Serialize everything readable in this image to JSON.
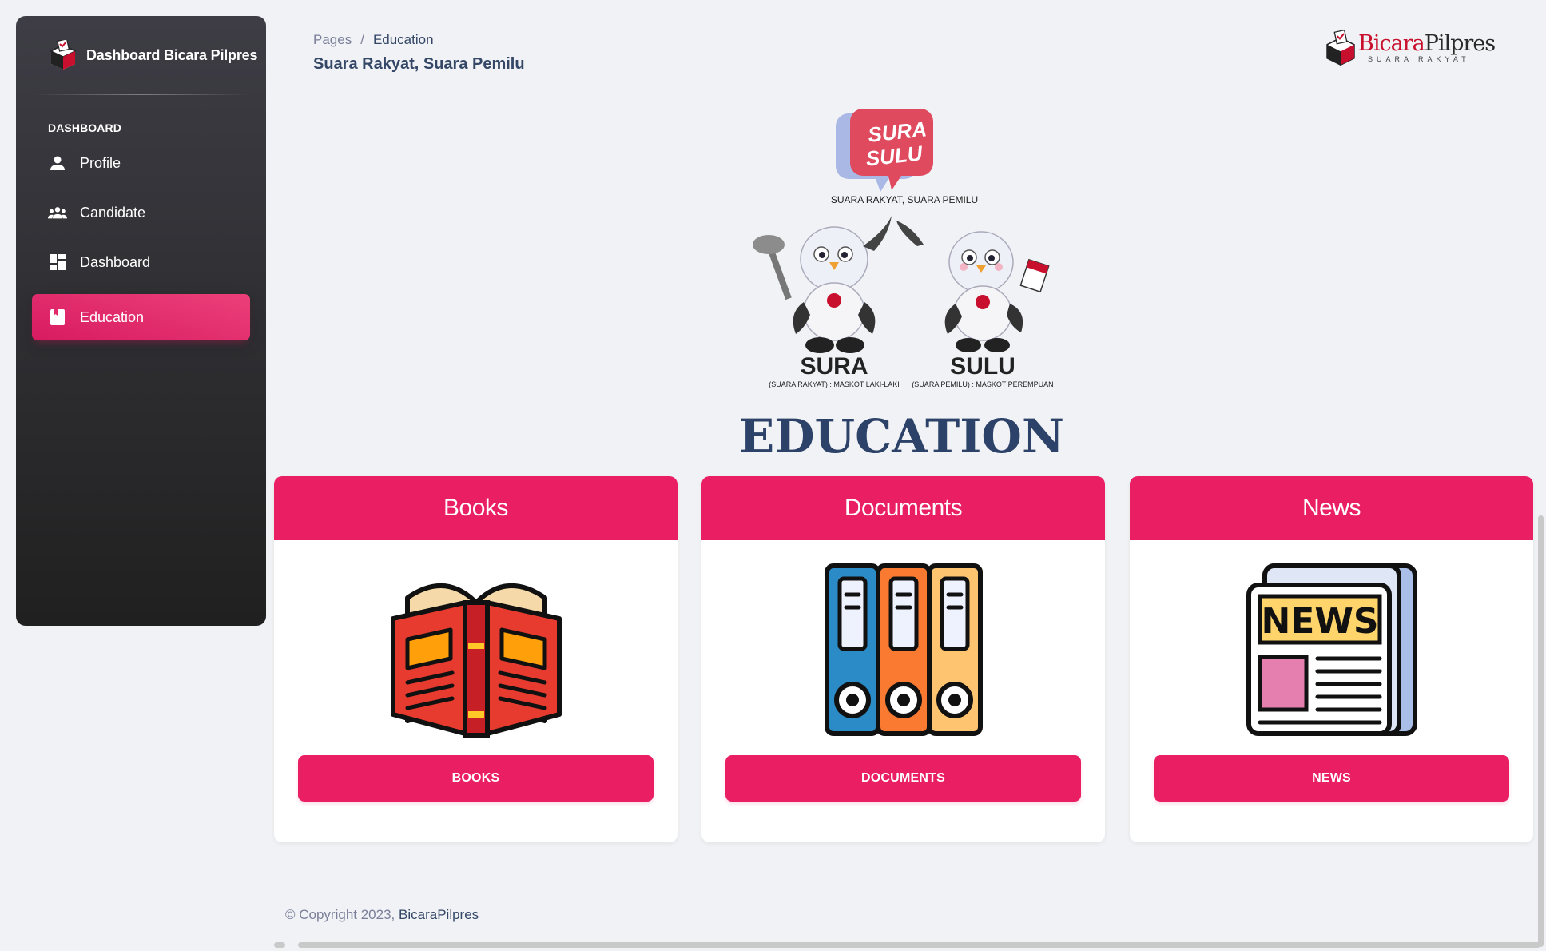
{
  "sidebar": {
    "brand": "Dashboard Bicara Pilpres",
    "section_label": "DASHBOARD",
    "items": [
      {
        "label": "Profile",
        "icon": "person-icon",
        "active": false
      },
      {
        "label": "Candidate",
        "icon": "group-icon",
        "active": false
      },
      {
        "label": "Dashboard",
        "icon": "dashboard-icon",
        "active": false
      },
      {
        "label": "Education",
        "icon": "book-icon",
        "active": true
      }
    ]
  },
  "header": {
    "breadcrumb_root": "Pages",
    "breadcrumb_separator": "/",
    "breadcrumb_current": "Education",
    "title": "Suara Rakyat, Suara Pemilu",
    "logo": {
      "brand_red": "Bicara",
      "brand_dark": "Pilpres",
      "tagline": "SUARA RAKYAT"
    }
  },
  "mascot": {
    "bubble_line1": "SURA",
    "bubble_line2": "SULU",
    "tagline": "SUARA RAKYAT, SUARA PEMILU",
    "left_name": "SURA",
    "left_caption": "(SUARA RAKYAT) : MASKOT LAKI-LAKI",
    "right_name": "SULU",
    "right_caption": "(SUARA PEMILU) : MASKOT PEREMPUAN"
  },
  "main": {
    "heading": "EDUCATION",
    "cards": [
      {
        "title": "Books",
        "button": "BOOKS",
        "icon": "open-book-icon"
      },
      {
        "title": "Documents",
        "button": "DOCUMENTS",
        "icon": "binders-icon"
      },
      {
        "title": "News",
        "button": "NEWS",
        "icon": "newspaper-icon"
      }
    ]
  },
  "footer": {
    "prefix": "© Copyright 2023,",
    "brand": "BicaraPilpres"
  },
  "colors": {
    "accent": "#e91e63",
    "sidebar_top": "#3e3d45",
    "sidebar_bottom": "#202020",
    "heading": "#2d4268"
  }
}
